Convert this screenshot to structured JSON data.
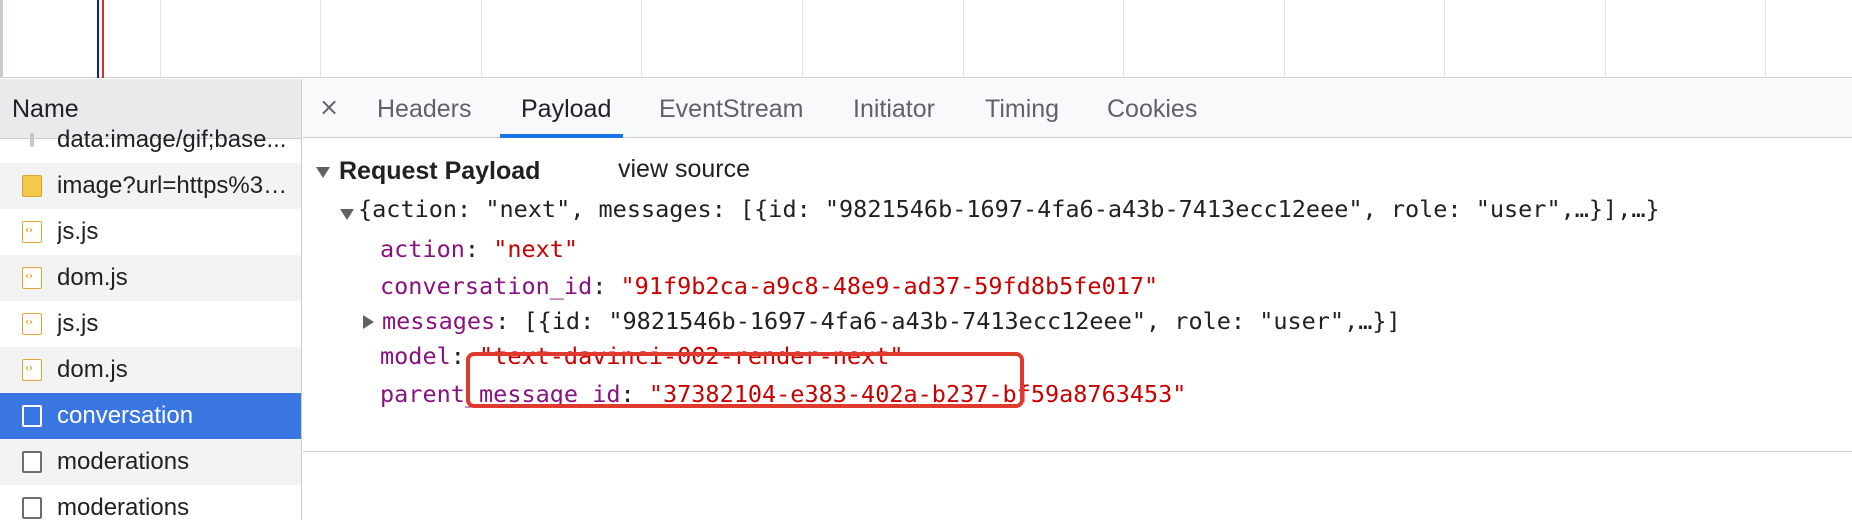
{
  "request_list": {
    "header": "Name",
    "rows": [
      {
        "label": "data:image/gif;base...",
        "icon": "gif-icon",
        "selected": false
      },
      {
        "label": "image?url=https%3A...",
        "icon": "image-icon",
        "selected": false
      },
      {
        "label": "js.js",
        "icon": "script-icon",
        "selected": false
      },
      {
        "label": "dom.js",
        "icon": "script-icon",
        "selected": false
      },
      {
        "label": "js.js",
        "icon": "script-icon",
        "selected": false
      },
      {
        "label": "dom.js",
        "icon": "script-icon",
        "selected": false
      },
      {
        "label": "conversation",
        "icon": "document-icon",
        "selected": true
      },
      {
        "label": "moderations",
        "icon": "document-icon",
        "selected": false
      },
      {
        "label": "moderations",
        "icon": "document-icon",
        "selected": false
      }
    ]
  },
  "tabs": {
    "close": "×",
    "items": [
      "Headers",
      "Payload",
      "EventStream",
      "Initiator",
      "Timing",
      "Cookies"
    ],
    "active": "Payload"
  },
  "payload": {
    "section_title": "Request Payload",
    "view_source": "view source",
    "summary": "{action: \"next\", messages: [{id: \"9821546b-1697-4fa6-a43b-7413ecc12eee\", role: \"user\",…}],…}",
    "fields": {
      "action_key": "action",
      "action_value": "\"next\"",
      "conversation_id_key": "conversation_id",
      "conversation_id_value": "\"91f9b2ca-a9c8-48e9-ad37-59fd8b5fe017\"",
      "messages_key": "messages",
      "messages_value": "[{id: \"9821546b-1697-4fa6-a43b-7413ecc12eee\", role: \"user\",…}]",
      "model_key": "model",
      "model_value": "\"text-davinci-002-render-next\"",
      "parent_message_id_key": "parent_message_id",
      "parent_message_id_value": "\"37382104-e383-402a-b237-bf59a8763453\""
    },
    "separator": ": "
  },
  "colors": {
    "key": "#881280",
    "string": "#c80000",
    "selection": "#3a76e2",
    "active_tab_underline": "#1a73e8",
    "annotation_box": "#e03a2f"
  }
}
